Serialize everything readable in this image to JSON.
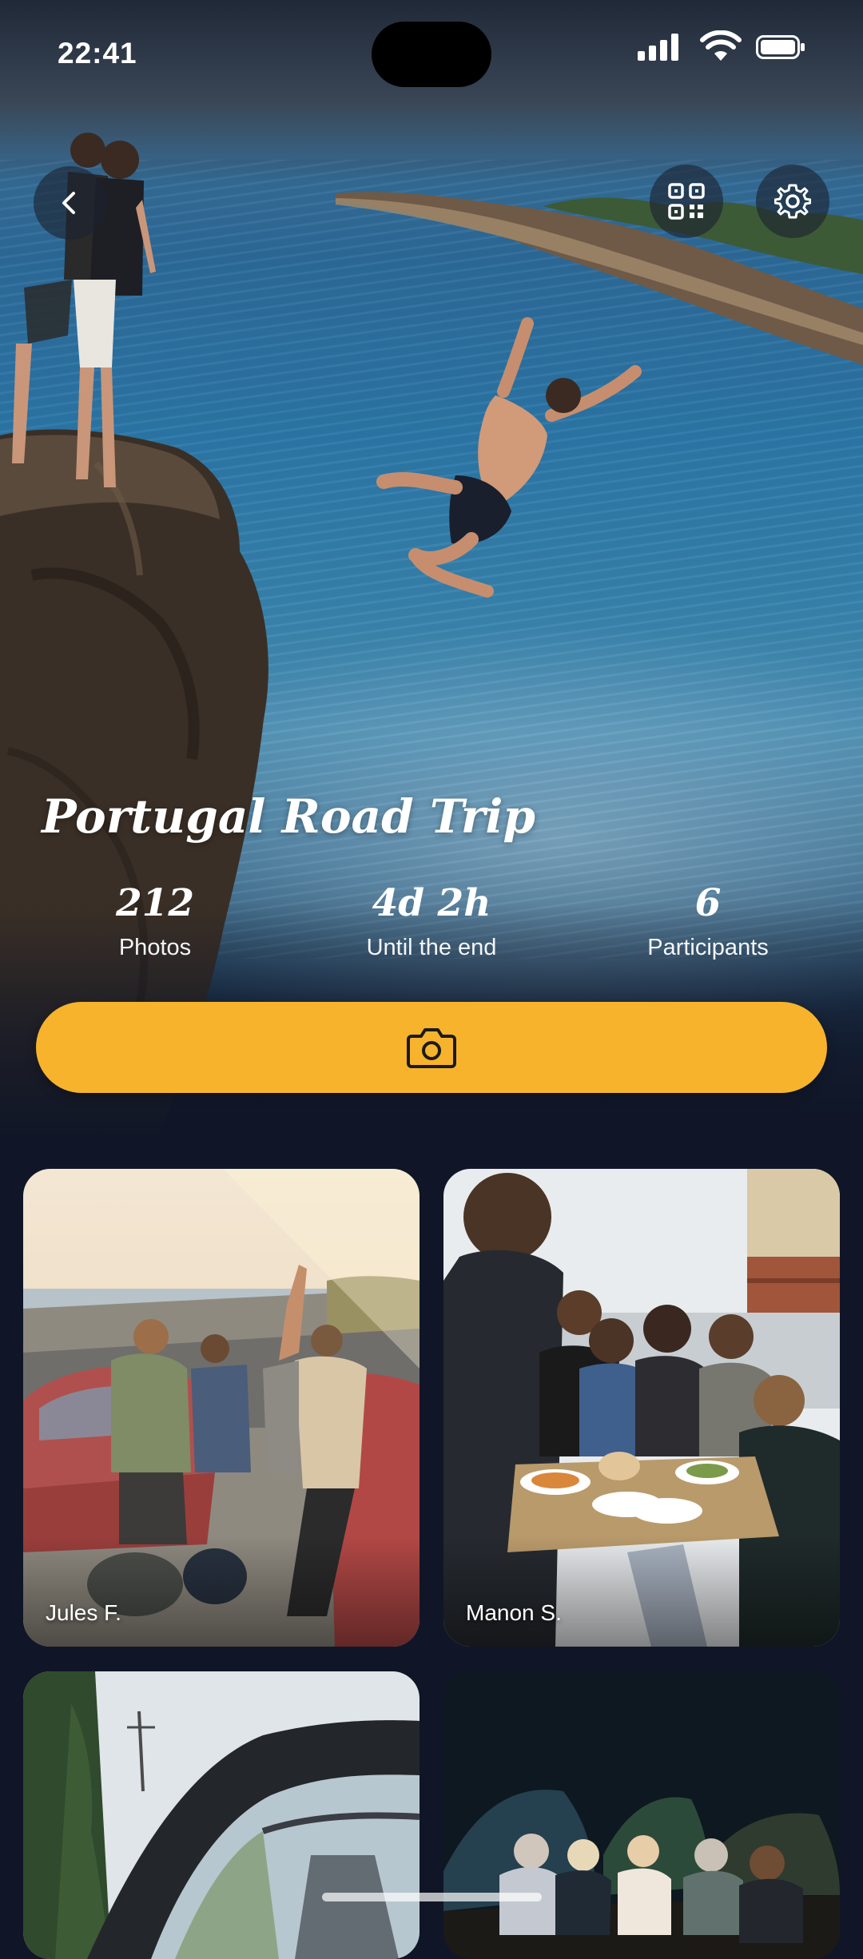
{
  "status_bar": {
    "time": "22:41"
  },
  "header": {
    "back_icon": "chevron-left-icon",
    "qr_icon": "qr-code-icon",
    "settings_icon": "gear-icon"
  },
  "trip": {
    "title": "Portugal Road Trip",
    "stats": [
      {
        "value": "212",
        "label": "Photos"
      },
      {
        "value": "4d 2h",
        "label": "Until the end"
      },
      {
        "value": "6",
        "label": "Participants"
      }
    ]
  },
  "camera_button": {
    "icon": "camera-icon",
    "color": "#F7B32B"
  },
  "photos": [
    {
      "author": "Jules F."
    },
    {
      "author": "Manon S."
    },
    {
      "author": ""
    },
    {
      "author": ""
    }
  ],
  "colors": {
    "background": "#101627",
    "accent": "#F7B32B"
  }
}
